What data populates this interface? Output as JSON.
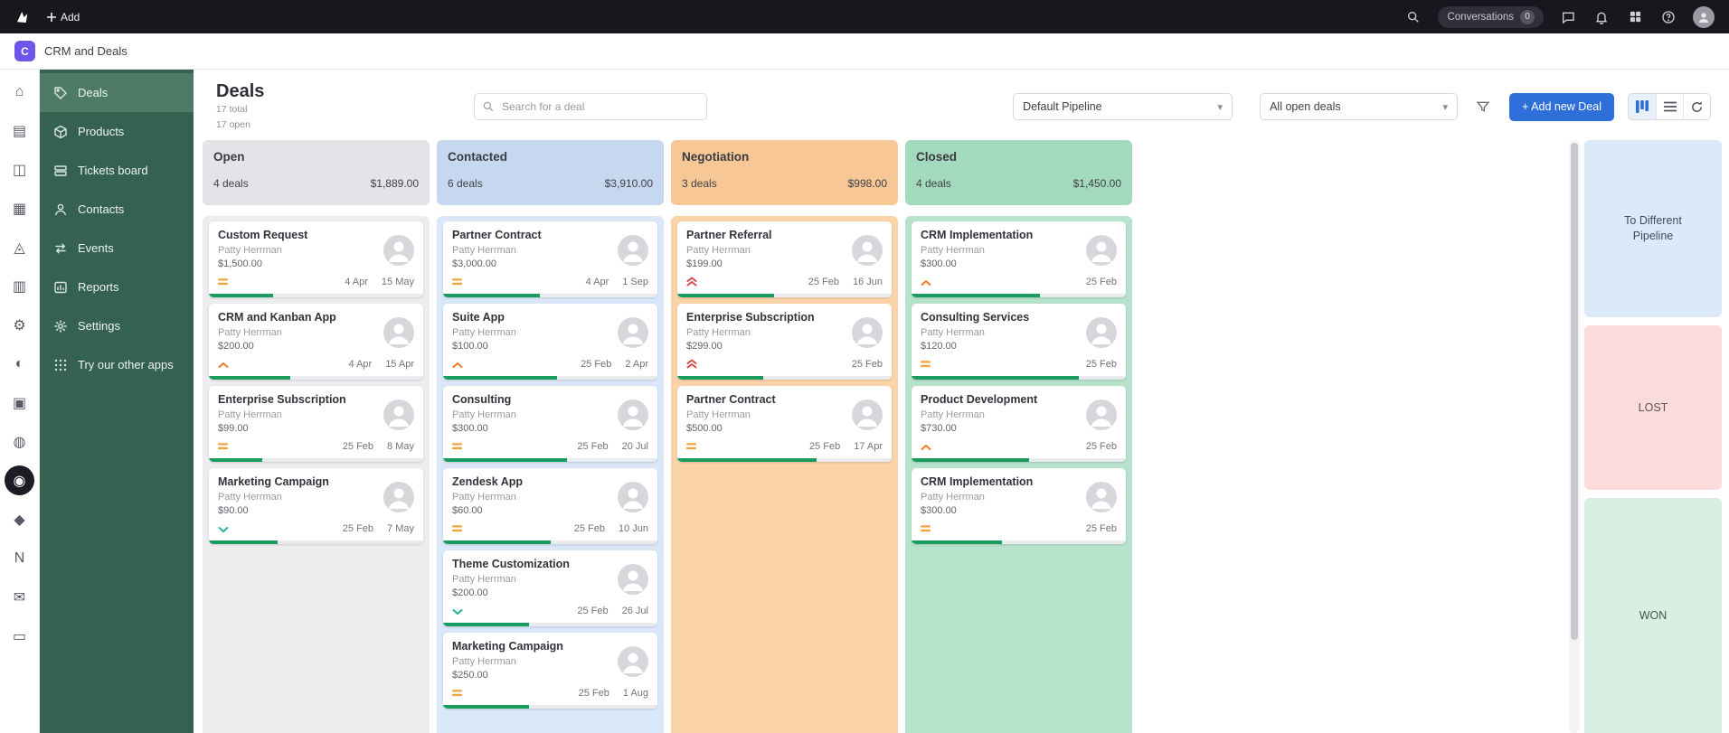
{
  "topbar": {
    "add_label": "Add",
    "conversations_label": "Conversations",
    "conversations_count": "0"
  },
  "app_header": {
    "title": "CRM and Deals",
    "icon_letter": "C"
  },
  "rail": {
    "items": [
      {
        "name": "home-icon",
        "glyph": "⌂"
      },
      {
        "name": "tickets-icon",
        "glyph": "▤"
      },
      {
        "name": "contacts-icon",
        "glyph": "◫"
      },
      {
        "name": "departments-icon",
        "glyph": "▦"
      },
      {
        "name": "labs-icon",
        "glyph": "◬"
      },
      {
        "name": "analytics-icon",
        "glyph": "▥"
      },
      {
        "name": "settings-icon",
        "glyph": "⚙"
      },
      {
        "name": "integrations-icon",
        "glyph": "◐"
      },
      {
        "name": "security-icon",
        "glyph": "▣"
      },
      {
        "name": "messages-icon",
        "glyph": "◍"
      },
      {
        "name": "browser-icon",
        "glyph": "◉",
        "active": true
      },
      {
        "name": "design-icon",
        "glyph": "◆"
      },
      {
        "name": "notes-icon",
        "glyph": "N"
      },
      {
        "name": "mail-icon",
        "glyph": "✉"
      },
      {
        "name": "apps-icon",
        "glyph": "▭"
      }
    ]
  },
  "sidebar": {
    "items": [
      {
        "label": "Deals",
        "active": true
      },
      {
        "label": "Products"
      },
      {
        "label": "Tickets board"
      },
      {
        "label": "Contacts"
      },
      {
        "label": "Events"
      },
      {
        "label": "Reports"
      },
      {
        "label": "Settings"
      },
      {
        "label": "Try our other apps"
      }
    ]
  },
  "deals_header": {
    "title": "Deals",
    "total": "17 total",
    "open": "17 open",
    "search_placeholder": "Search for a deal",
    "pipeline_select": "Default Pipeline",
    "filter_select": "All open deals",
    "add_deal_label": "+ Add new Deal"
  },
  "board": {
    "progress_color": "#1a9c5e",
    "columns": [
      {
        "key": "open",
        "name": "Open",
        "deals": "4 deals",
        "amount": "$1,889.00",
        "header_color": "#e3e3e8",
        "body_color": "#ededf0",
        "cards": [
          {
            "title": "Custom Request",
            "owner": "Patty Herrman",
            "amount": "$1,500.00",
            "priority": "medium",
            "start": "4 Apr",
            "end": "15 May",
            "progress": 30
          },
          {
            "title": "CRM and Kanban App",
            "owner": "Patty Herrman",
            "amount": "$200.00",
            "priority": "high",
            "start": "4 Apr",
            "end": "15 Apr",
            "progress": 38
          },
          {
            "title": "Enterprise Subscription",
            "owner": "Patty Herrman",
            "amount": "$99.00",
            "priority": "medium",
            "start": "25 Feb",
            "end": "8 May",
            "progress": 25
          },
          {
            "title": "Marketing Campaign",
            "owner": "Patty Herrman",
            "amount": "$90.00",
            "priority": "low",
            "start": "25 Feb",
            "end": "7 May",
            "progress": 32
          }
        ]
      },
      {
        "key": "contacted",
        "name": "Contacted",
        "deals": "6 deals",
        "amount": "$3,910.00",
        "header_color": "#c6d8f0",
        "body_color": "#d9e7f8",
        "cards": [
          {
            "title": "Partner Contract",
            "owner": "Patty Herrman",
            "amount": "$3,000.00",
            "priority": "medium",
            "start": "4 Apr",
            "end": "1 Sep",
            "progress": 45
          },
          {
            "title": "Suite App",
            "owner": "Patty Herrman",
            "amount": "$100.00",
            "priority": "high",
            "start": "25 Feb",
            "end": "2 Apr",
            "progress": 53
          },
          {
            "title": "Consulting",
            "owner": "Patty Herrman",
            "amount": "$300.00",
            "priority": "medium",
            "start": "25 Feb",
            "end": "20 Jul",
            "progress": 58
          },
          {
            "title": "Zendesk App",
            "owner": "Patty Herrman",
            "amount": "$60.00",
            "priority": "medium",
            "start": "25 Feb",
            "end": "10 Jun",
            "progress": 50
          },
          {
            "title": "Theme Customization",
            "owner": "Patty Herrman",
            "amount": "$200.00",
            "priority": "low",
            "start": "25 Feb",
            "end": "26 Jul",
            "progress": 40
          },
          {
            "title": "Marketing Campaign",
            "owner": "Patty Herrman",
            "amount": "$250.00",
            "priority": "medium",
            "start": "25 Feb",
            "end": "1 Aug",
            "progress": 40
          }
        ]
      },
      {
        "key": "negotiation",
        "name": "Negotiation",
        "deals": "3 deals",
        "amount": "$998.00",
        "header_color": "#f7c795",
        "body_color": "#fbd3a9",
        "cards": [
          {
            "title": "Partner Referral",
            "owner": "Patty Herrman",
            "amount": "$199.00",
            "priority": "highest",
            "start": "25 Feb",
            "end": "16 Jun",
            "progress": 45
          },
          {
            "title": "Enterprise Subscription",
            "owner": "Patty Herrman",
            "amount": "$299.00",
            "priority": "highest",
            "start": "25 Feb",
            "end": "",
            "progress": 40
          },
          {
            "title": "Partner Contract",
            "owner": "Patty Herrman",
            "amount": "$500.00",
            "priority": "medium",
            "start": "25 Feb",
            "end": "17 Apr",
            "progress": 65
          }
        ]
      },
      {
        "key": "closed",
        "name": "Closed",
        "deals": "4 deals",
        "amount": "$1,450.00",
        "header_color": "#a3dabd",
        "body_color": "#b7e2cb",
        "cards": [
          {
            "title": "CRM Implementation",
            "owner": "Patty Herrman",
            "amount": "$300.00",
            "priority": "high",
            "start": "25 Feb",
            "end": "",
            "progress": 60
          },
          {
            "title": "Consulting Services",
            "owner": "Patty Herrman",
            "amount": "$120.00",
            "priority": "medium",
            "start": "25 Feb",
            "end": "",
            "progress": 78
          },
          {
            "title": "Product Development",
            "owner": "Patty Herrman",
            "amount": "$730.00",
            "priority": "high",
            "start": "25 Feb",
            "end": "",
            "progress": 55
          },
          {
            "title": "CRM Implementation",
            "owner": "Patty Herrman",
            "amount": "$300.00",
            "priority": "medium",
            "start": "25 Feb",
            "end": "",
            "progress": 42
          }
        ]
      }
    ]
  },
  "dropzones": [
    {
      "label": "To Different Pipeline",
      "color": "#dbe9f8"
    },
    {
      "label": "LOST",
      "color": "#fcdcda"
    },
    {
      "label": "WON",
      "color": "#d9efe3"
    }
  ]
}
